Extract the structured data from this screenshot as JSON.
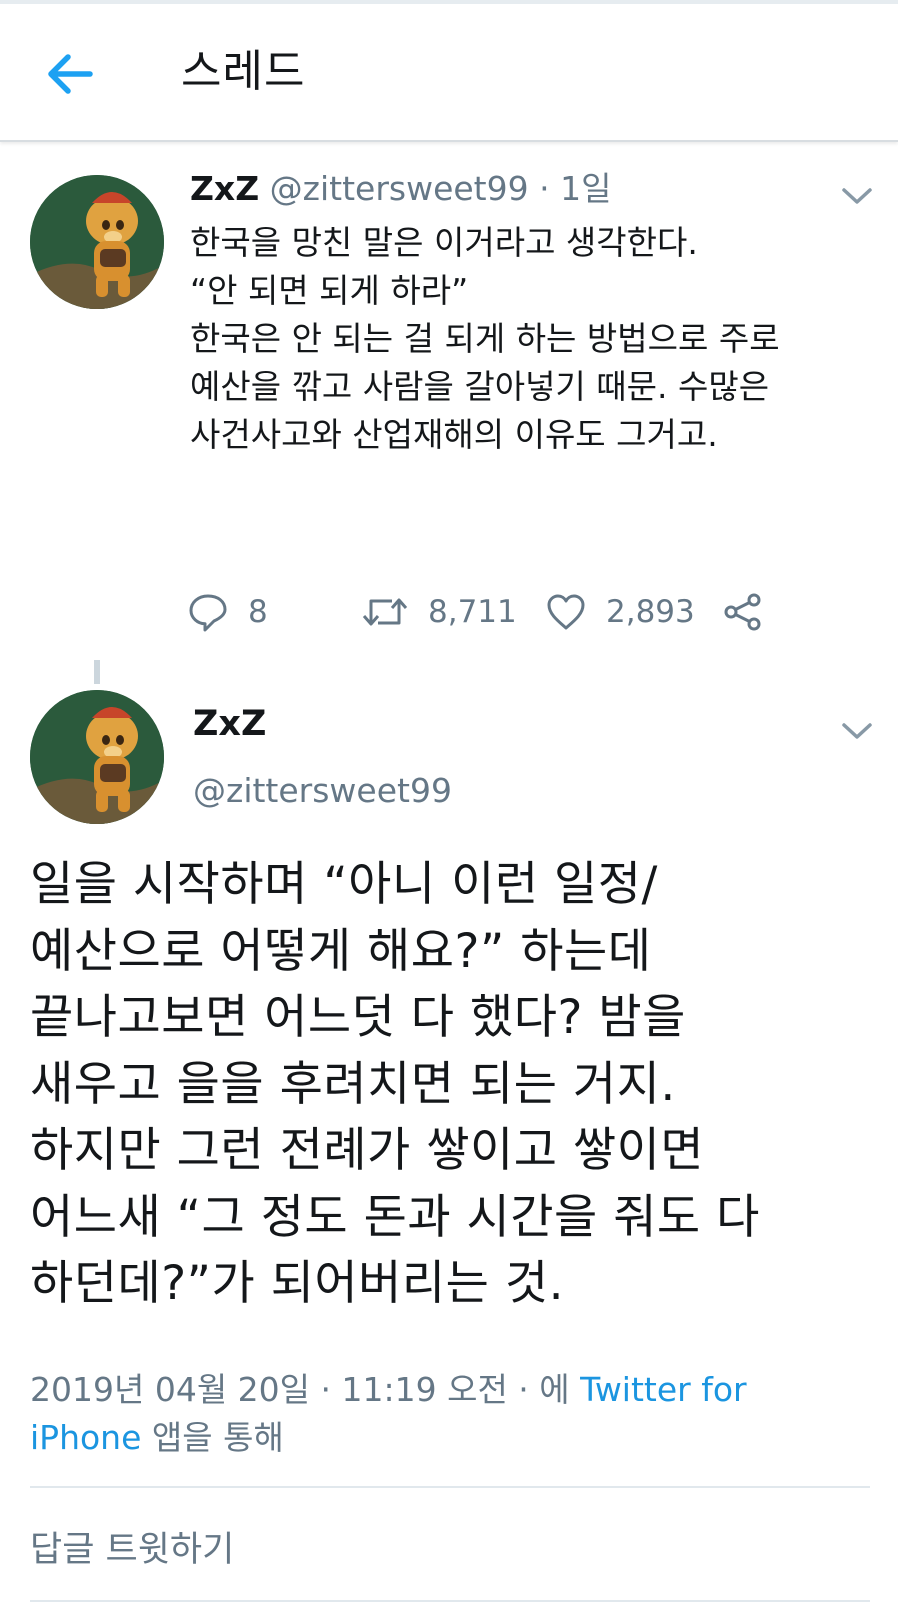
{
  "header": {
    "title": "스레드",
    "back_icon": "arrow-left-icon",
    "accent_color": "#1da1f2"
  },
  "tweet1": {
    "name": "ZxZ",
    "handle": "@zittersweet99",
    "time": " · 1일",
    "body": [
      "한국을 망친 말은 이거라고 생각한다.",
      "",
      "“안 되면 되게 하라”",
      "",
      "한국은 안 되는 걸 되게 하는 방법으로 주로",
      "예산을 깎고 사람을 갈아넣기 때문. 수많은",
      "사건사고와 산업재해의 이유도 그거고."
    ],
    "replies": "8",
    "retweets": "8,711",
    "likes": "2,893"
  },
  "tweet2": {
    "name": "ZxZ",
    "handle": "@zittersweet99",
    "body": [
      "일을 시작하며 “아니 이런 일정/",
      "예산으로 어떻게 해요?” 하는데",
      "끝나고보면 어느덧 다 했다? 밤을",
      "새우고 을을 후려치면 되는 거지.",
      "하지만 그런 전례가 쌓이고 쌓이면",
      "어느새 “그 정도 돈과 시간을 줘도 다",
      "하던데?”가 되어버리는 것."
    ],
    "date_prefix": "2019년 04월 20일 · 11:19 오전 · 에 ",
    "source_link_1": "Twitter for",
    "source_link_2": "iPhone",
    "source_suffix": " 앱을 통해"
  },
  "reply_box": {
    "placeholder": "답글 트윗하기"
  },
  "colors": {
    "text": "#14171a",
    "secondary": "#657786",
    "link": "#1b95e0",
    "divider": "#e1e8ed"
  }
}
